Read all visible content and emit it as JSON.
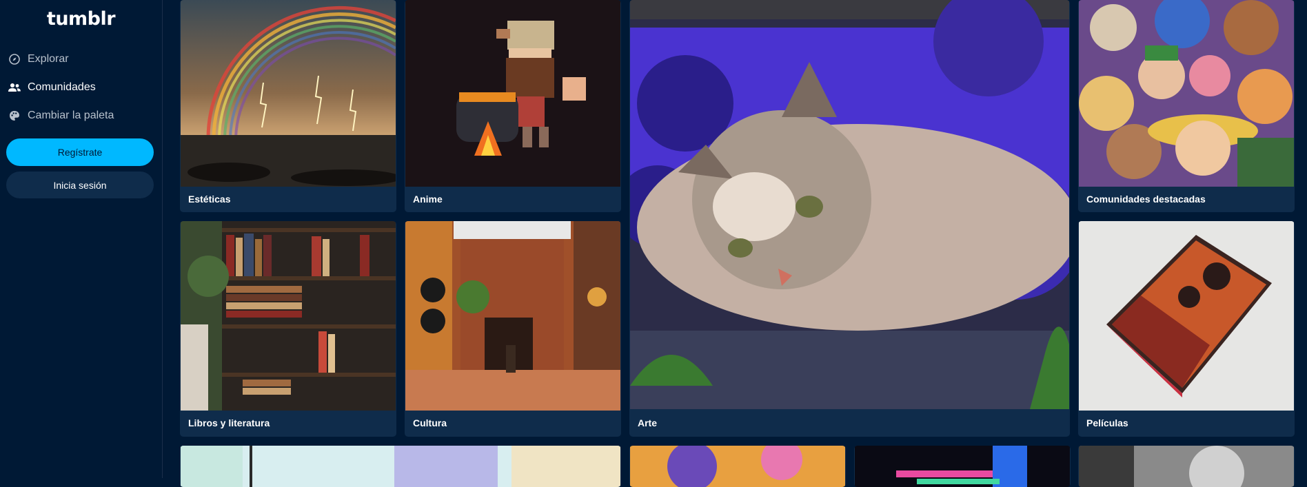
{
  "sidebar": {
    "logo": "tumblr",
    "nav": [
      {
        "label": "Explorar",
        "icon": "compass-icon",
        "active": false
      },
      {
        "label": "Comunidades",
        "icon": "people-icon",
        "active": true
      },
      {
        "label": "Cambiar la paleta",
        "icon": "palette-icon",
        "active": false
      }
    ],
    "register_label": "Regístrate",
    "login_label": "Inicia sesión"
  },
  "tiles": [
    {
      "label": "Estéticas",
      "image": "rainbow-storm-seascape"
    },
    {
      "label": "Anime",
      "image": "pixel-art-dwarf-cauldron"
    },
    {
      "label": "Arte",
      "image": "cat-among-purple-flowers"
    },
    {
      "label": "Comunidades destacadas",
      "image": "anime-crew-collage"
    },
    {
      "label": "Libros y literatura",
      "image": "bookshelves-interior"
    },
    {
      "label": "Cultura",
      "image": "patterned-african-courtyard"
    },
    {
      "label": "Películas",
      "image": "goncharov-dvd-case"
    },
    {
      "label": "",
      "image": "cartoon-illustration"
    },
    {
      "label": "",
      "image": "colorful-flower-illustration"
    },
    {
      "label": "",
      "image": "neon-hand-graphic"
    },
    {
      "label": "",
      "image": "black-white-photo"
    }
  ],
  "colors": {
    "background": "#001935",
    "card": "#0f2c4b",
    "accent": "#00b8ff"
  }
}
